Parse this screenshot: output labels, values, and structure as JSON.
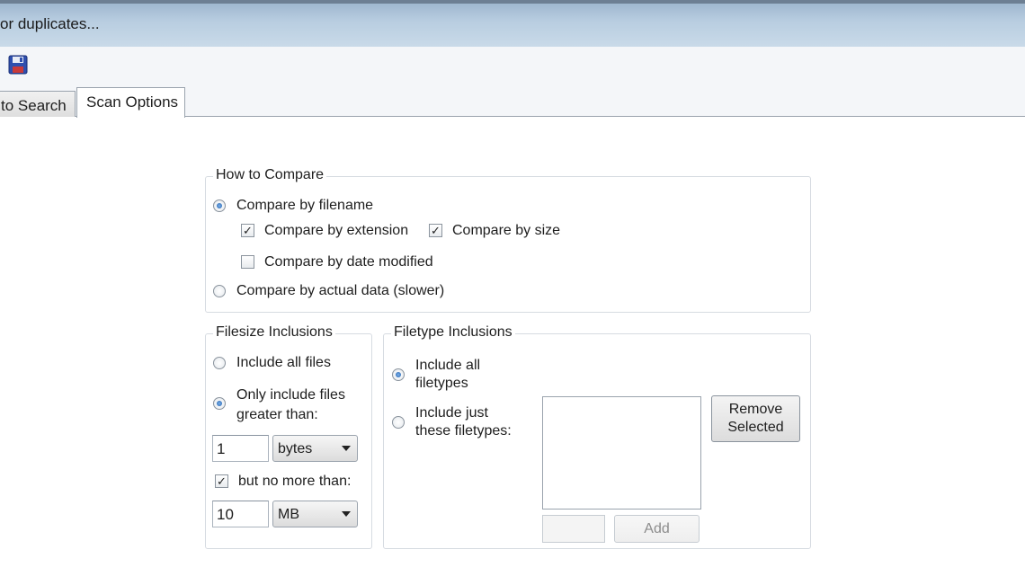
{
  "window": {
    "title": "or duplicates..."
  },
  "toolbar": {
    "save_icon": "save-icon"
  },
  "tabs": [
    {
      "label": "to Search"
    },
    {
      "label": "Scan Options"
    }
  ],
  "how_to_compare": {
    "legend": "How to Compare",
    "by_filename": "Compare by filename",
    "by_extension": "Compare by extension",
    "by_size": "Compare by size",
    "by_date": "Compare by date modified",
    "by_data": "Compare by actual data (slower)"
  },
  "filesize": {
    "legend": "Filesize Inclusions",
    "include_all": "Include all files",
    "only_greater_line1": "Only include files",
    "only_greater_line2": "greater than:",
    "min_value": "1",
    "min_unit": "bytes",
    "no_more_than": "but no more than:",
    "max_value": "10",
    "max_unit": "MB"
  },
  "filetype": {
    "legend": "Filetype Inclusions",
    "include_all_line1": "Include all",
    "include_all_line2": "filetypes",
    "include_just_line1": "Include just",
    "include_just_line2": "these filetypes:",
    "remove_line1": "Remove",
    "remove_line2": "Selected",
    "add": "Add",
    "new_type_value": ""
  }
}
